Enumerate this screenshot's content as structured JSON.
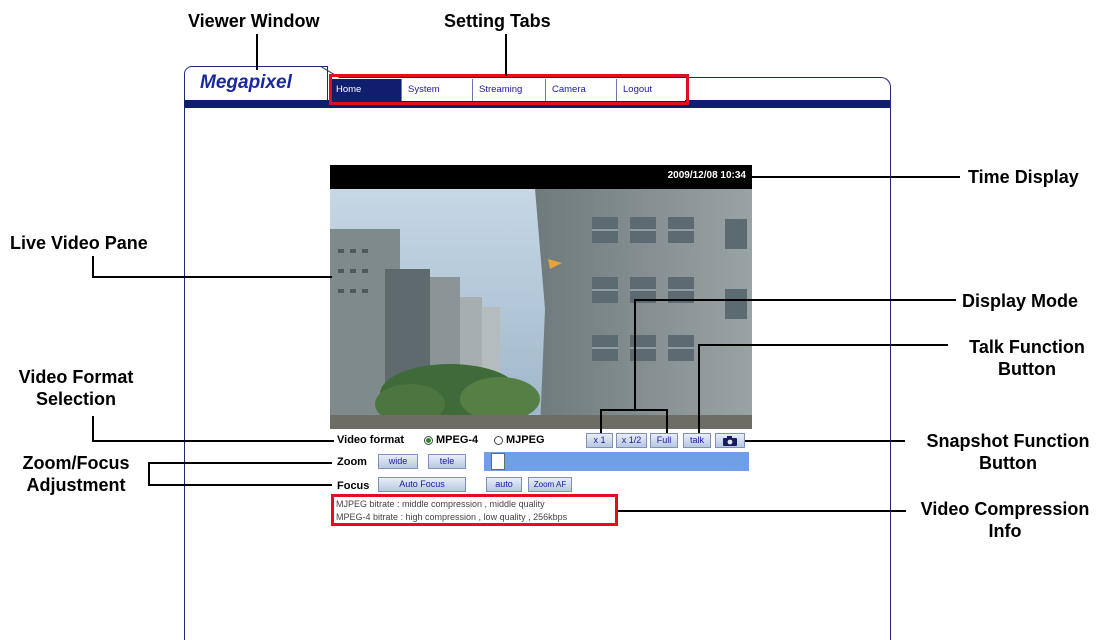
{
  "annotations": {
    "viewer_window": "Viewer Window",
    "setting_tabs": "Setting Tabs",
    "time_display": "Time Display",
    "live_video_pane": "Live Video Pane",
    "display_mode": "Display Mode",
    "talk_function_line1": "Talk Function",
    "talk_function_line2": "Button",
    "video_format_line1": "Video Format",
    "video_format_line2": "Selection",
    "snapshot_line1": "Snapshot Function",
    "snapshot_line2": "Button",
    "zoom_focus_line1": "Zoom/Focus",
    "zoom_focus_line2": "Adjustment",
    "compression_line1": "Video Compression",
    "compression_line2": "Info"
  },
  "viewer": {
    "logo": "Megapixel",
    "tabs": [
      {
        "label": "Home",
        "active": true
      },
      {
        "label": "System",
        "active": false
      },
      {
        "label": "Streaming",
        "active": false
      },
      {
        "label": "Camera",
        "active": false
      },
      {
        "label": "Logout",
        "active": false
      }
    ],
    "timestamp": "2009/12/08 10:34",
    "video_format": {
      "label": "Video format",
      "options": [
        "MPEG-4",
        "MJPEG"
      ],
      "selected": "MPEG-4"
    },
    "display_modes": [
      "x 1",
      "x 1/2",
      "Full"
    ],
    "talk_button": "talk",
    "snapshot_icon": "camera-icon",
    "zoom": {
      "label": "Zoom",
      "wide": "wide",
      "tele": "tele",
      "level": 0.02
    },
    "focus": {
      "label": "Focus",
      "auto_focus": "Auto Focus",
      "auto": "auto",
      "zoom_af": "Zoom AF"
    },
    "compression_info": [
      "MJPEG bitrate : middle compression , middle quality",
      "MPEG-4 bitrate : high compression , low quality , 256kbps"
    ]
  },
  "colors": {
    "accent": "#0f1f6e",
    "highlight": "#e01020",
    "slider": "#6f9fe6"
  }
}
